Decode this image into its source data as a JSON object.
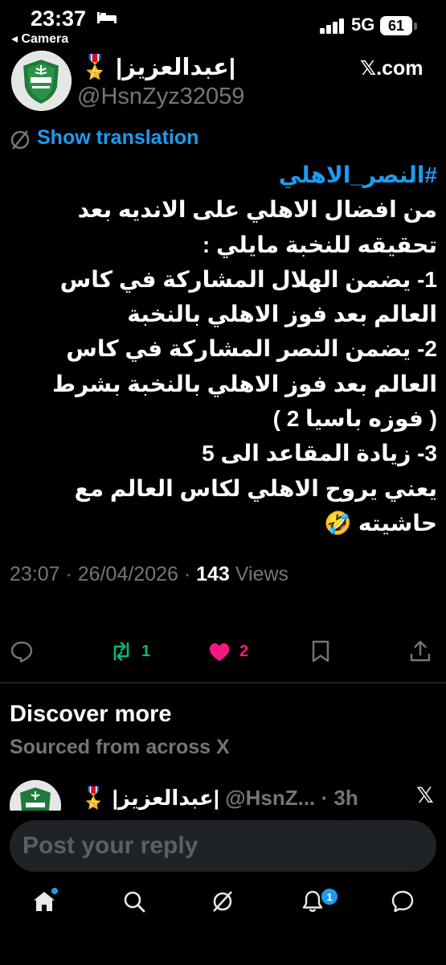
{
  "status_bar": {
    "time": "23:37",
    "back_label": "◂ Camera",
    "network": "5G",
    "battery": "61"
  },
  "post": {
    "display_name": "🎖️ |عبدالعزيز|",
    "handle": "@HsnZyz32059",
    "site": "𝕏.com",
    "translate_label": "Show translation",
    "hashtag": "#النصر_الاهلي",
    "lines": [
      "من افضال الاهلي على الانديه بعد",
      "تحقيقه للنخبة مايلي :",
      "1- يضمن الهلال المشاركة في كاس",
      "العالم بعد فوز الاهلي بالنخبة",
      "2- يضمن النصر المشاركة في كاس",
      "العالم بعد فوز الاهلي بالنخبة بشرط",
      "( فوزه باسيا 2 )",
      "3- زيادة المقاعد الى 5",
      "يعني يروح الاهلي لكاس العالم مع",
      "حاشيته 🤣"
    ],
    "time": "23:07",
    "date": "26/04/2026",
    "views_count": "143",
    "views_label": "Views"
  },
  "actions": {
    "retweets": "1",
    "likes": "2"
  },
  "discover": {
    "title": "Discover more",
    "subtitle": "Sourced from across X",
    "rec_name": "🎖️ |عبدالعزيز|",
    "rec_handle": "@HsnZ...",
    "rec_time": "3h",
    "rec_x": "𝕏"
  },
  "reply": {
    "placeholder": "Post your reply"
  },
  "nav": {
    "notif_count": "1"
  },
  "colors": {
    "accent": "#1d9bf0",
    "retweet": "#00ba7c",
    "like": "#f91880",
    "muted": "#71767b"
  }
}
